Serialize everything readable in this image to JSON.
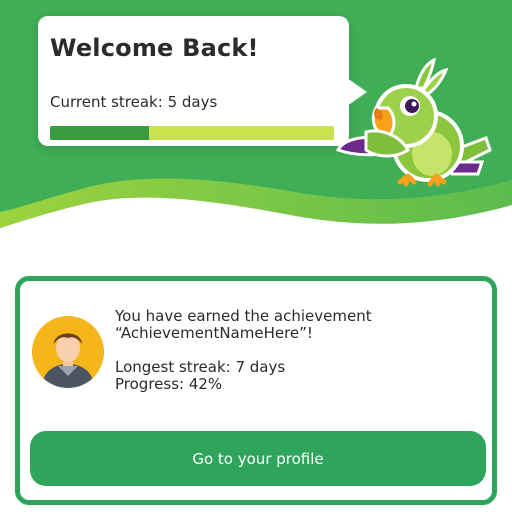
{
  "header": {
    "title": "Welcome Back!",
    "streak_label": "Current streak: 5 days",
    "streak_progress": 0.35
  },
  "mascot": {
    "icon": "parrot-icon"
  },
  "achievement": {
    "line1": "You have earned the achievement",
    "line2": "“AchievementNameHere”!",
    "longest_streak": "Longest streak: 7 days",
    "progress": "Progress: 42%",
    "avatar_icon": "user-avatar-icon"
  },
  "actions": {
    "profile_button": "Go to your profile"
  },
  "colors": {
    "primary_green": "#2ea55b",
    "dark_green": "#3a9a3f",
    "light_green": "#c9e24d",
    "avatar_bg": "#f5b51b"
  }
}
